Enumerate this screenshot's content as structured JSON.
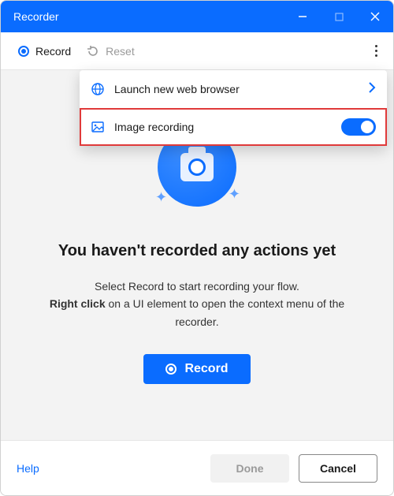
{
  "window": {
    "title": "Recorder"
  },
  "toolbar": {
    "record_label": "Record",
    "reset_label": "Reset"
  },
  "dropdown": {
    "items": [
      {
        "label": "Launch new web browser"
      },
      {
        "label": "Image recording",
        "toggle_on": true
      }
    ]
  },
  "main": {
    "heading": "You haven't recorded any actions yet",
    "line1": "Select Record to start recording your flow.",
    "line2_strong": "Right click",
    "line2_rest": " on a UI element to open the context menu of the recorder.",
    "record_button": "Record"
  },
  "footer": {
    "help": "Help",
    "done": "Done",
    "cancel": "Cancel"
  }
}
